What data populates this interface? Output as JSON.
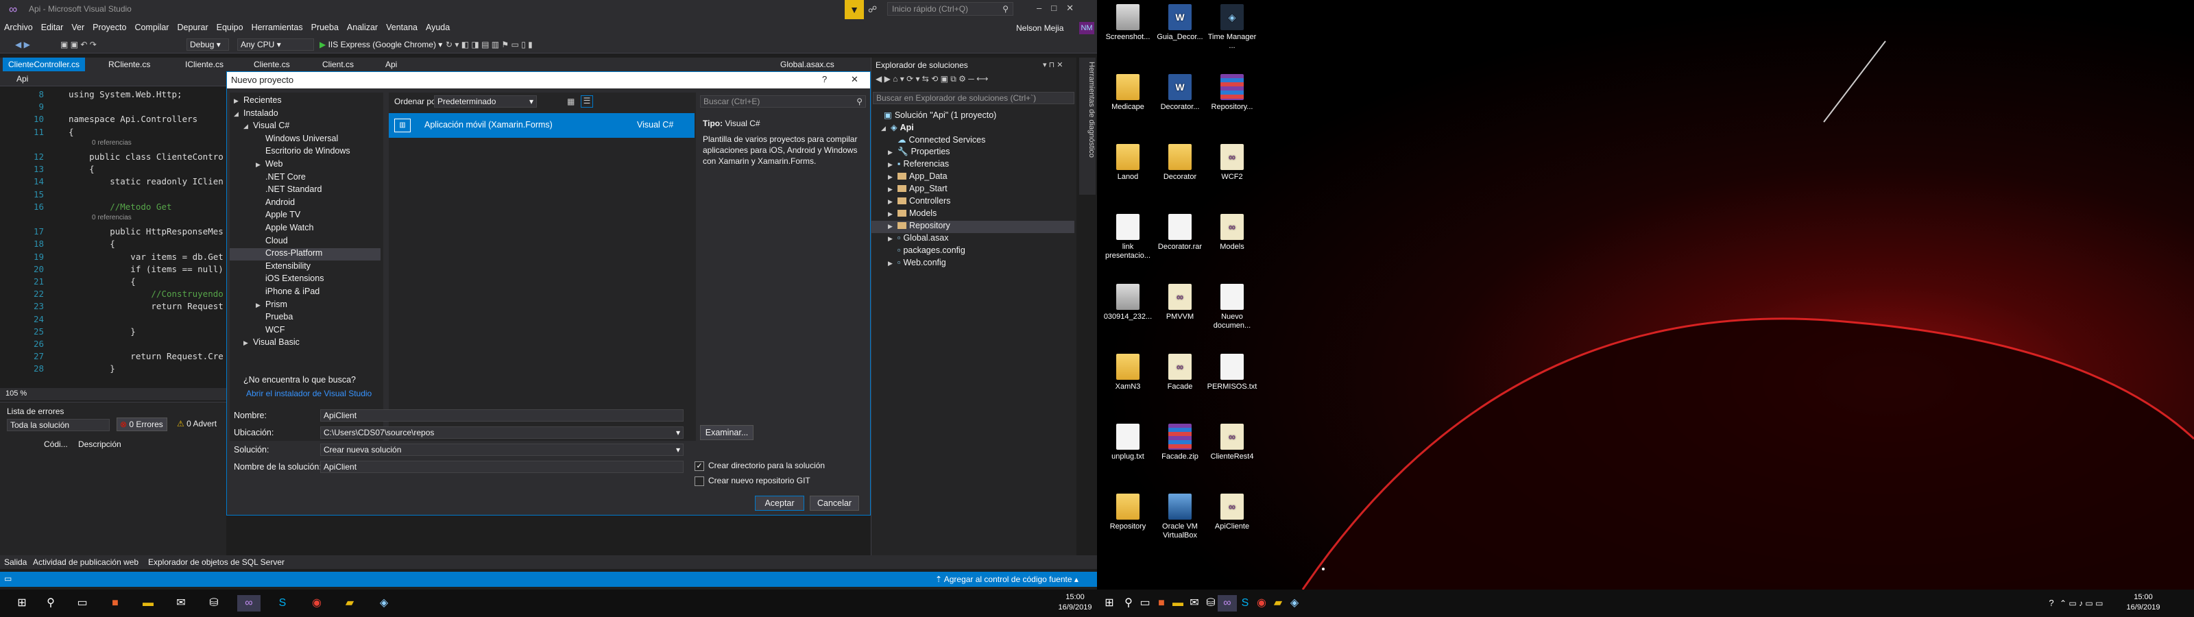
{
  "vs": {
    "title": "Api - Microsoft Visual Studio",
    "quick_launch": "Inicio rápido (Ctrl+Q)",
    "user": "Nelson Mejia",
    "user_initials": "NM",
    "menu": [
      "Archivo",
      "Editar",
      "Ver",
      "Proyecto",
      "Compilar",
      "Depurar",
      "Equipo",
      "Herramientas",
      "Prueba",
      "Analizar",
      "Ventana",
      "Ayuda"
    ],
    "toolbar": {
      "config": "Debug",
      "platform": "Any CPU",
      "run": "IIS Express (Google Chrome)"
    },
    "tabs": [
      "ClienteController.cs",
      "RCliente.cs",
      "ICliente.cs",
      "Cliente.cs",
      "Client.cs",
      "Api",
      "Global.asax.cs"
    ],
    "nav": "Api",
    "code": [
      {
        "n": "8",
        "t": "using System.Web.Http;"
      },
      {
        "n": "9",
        "t": ""
      },
      {
        "n": "10",
        "t": "namespace Api.Controllers"
      },
      {
        "n": "11",
        "t": "{"
      },
      {
        "n": "",
        "t": "0 referencias"
      },
      {
        "n": "12",
        "t": "    public class ClienteContro"
      },
      {
        "n": "13",
        "t": "    {"
      },
      {
        "n": "14",
        "t": "        static readonly IClien"
      },
      {
        "n": "15",
        "t": ""
      },
      {
        "n": "16",
        "t": "        //Metodo Get"
      },
      {
        "n": "",
        "t": "0 referencias"
      },
      {
        "n": "17",
        "t": "        public HttpResponseMes"
      },
      {
        "n": "18",
        "t": "        {"
      },
      {
        "n": "19",
        "t": "            var items = db.Get"
      },
      {
        "n": "20",
        "t": "            if (items == null)"
      },
      {
        "n": "21",
        "t": "            {"
      },
      {
        "n": "22",
        "t": "                //Construyendo"
      },
      {
        "n": "23",
        "t": "                return Request"
      },
      {
        "n": "24",
        "t": ""
      },
      {
        "n": "25",
        "t": "            }"
      },
      {
        "n": "26",
        "t": ""
      },
      {
        "n": "27",
        "t": "            return Request.Cre"
      },
      {
        "n": "28",
        "t": "        }"
      }
    ],
    "zoom": "105 %",
    "errors": {
      "title": "Lista de errores",
      "scope": "Toda la solución",
      "errors": "0 Errores",
      "warnings": "0 Advert",
      "col_code": "Códi...",
      "col_desc": "Descripción"
    },
    "bottom_tabs": [
      "Salida",
      "Actividad de publicación web",
      "Explorador de objetos de SQL Server"
    ],
    "status": "Agregar al control de código fuente"
  },
  "dialog": {
    "title": "Nuevo proyecto",
    "help": "?",
    "close": "✕",
    "tree": [
      {
        "label": "Recientes",
        "level": 0,
        "arrow": "▶"
      },
      {
        "label": "Instalado",
        "level": 0,
        "arrow": "◢"
      },
      {
        "label": "Visual C#",
        "level": 1,
        "arrow": "◢"
      },
      {
        "label": "Windows Universal",
        "level": 2,
        "arrow": ""
      },
      {
        "label": "Escritorio de Windows",
        "level": 2,
        "arrow": ""
      },
      {
        "label": "Web",
        "level": 2,
        "arrow": "▶"
      },
      {
        "label": ".NET Core",
        "level": 2,
        "arrow": ""
      },
      {
        "label": ".NET Standard",
        "level": 2,
        "arrow": ""
      },
      {
        "label": "Android",
        "level": 2,
        "arrow": ""
      },
      {
        "label": "Apple TV",
        "level": 2,
        "arrow": ""
      },
      {
        "label": "Apple Watch",
        "level": 2,
        "arrow": ""
      },
      {
        "label": "Cloud",
        "level": 2,
        "arrow": ""
      },
      {
        "label": "Cross-Platform",
        "level": 2,
        "arrow": "",
        "selected": true
      },
      {
        "label": "Extensibility",
        "level": 2,
        "arrow": ""
      },
      {
        "label": "iOS Extensions",
        "level": 2,
        "arrow": ""
      },
      {
        "label": "iPhone & iPad",
        "level": 2,
        "arrow": ""
      },
      {
        "label": "Prism",
        "level": 2,
        "arrow": "▶"
      },
      {
        "label": "Prueba",
        "level": 2,
        "arrow": ""
      },
      {
        "label": "WCF",
        "level": 2,
        "arrow": ""
      },
      {
        "label": "Visual Basic",
        "level": 1,
        "arrow": "▶"
      }
    ],
    "not_found": "¿No encuentra lo que busca?",
    "open_installer": "Abrir el instalador de Visual Studio",
    "sort_label": "Ordenar por:",
    "sort_value": "Predeterminado",
    "search_placeholder": "Buscar (Ctrl+E)",
    "template": {
      "name": "Aplicación móvil (Xamarin.Forms)",
      "lang": "Visual C#"
    },
    "type_label": "Tipo:",
    "type_value": "Visual C#",
    "description": "Plantilla de varios proyectos para compilar aplicaciones para iOS, Android y Windows con Xamarin y Xamarin.Forms.",
    "name_label": "Nombre:",
    "name_value": "ApiClient",
    "location_label": "Ubicación:",
    "location_value": "C:\\Users\\CDS07\\source\\repos",
    "solution_label": "Solución:",
    "solution_value": "Crear nueva solución",
    "solname_label": "Nombre de la solución:",
    "solname_value": "ApiClient",
    "browse": "Examinar...",
    "create_dir": "Crear directorio para la solución",
    "create_git": "Crear nuevo repositorio GIT",
    "ok": "Aceptar",
    "cancel": "Cancelar"
  },
  "solution_explorer": {
    "title": "Explorador de soluciones",
    "search": "Buscar en Explorador de soluciones (Ctrl+`)",
    "side_tab": "Herramientas de diagnóstico",
    "items": [
      {
        "label": "Solución \"Api\" (1 proyecto)",
        "level": 0,
        "icon": "solution"
      },
      {
        "label": "Api",
        "level": 1,
        "icon": "project",
        "bold": true
      },
      {
        "label": "Connected Services",
        "level": 2,
        "icon": "service"
      },
      {
        "label": "Properties",
        "level": 2,
        "icon": "wrench"
      },
      {
        "label": "Referencias",
        "level": 2,
        "icon": "refs"
      },
      {
        "label": "App_Data",
        "level": 2,
        "icon": "folder"
      },
      {
        "label": "App_Start",
        "level": 2,
        "icon": "folder"
      },
      {
        "label": "Controllers",
        "level": 2,
        "icon": "folder"
      },
      {
        "label": "Models",
        "level": 2,
        "icon": "folder"
      },
      {
        "label": "Repository",
        "level": 2,
        "icon": "folder",
        "selected": true
      },
      {
        "label": "Global.asax",
        "level": 2,
        "icon": "file"
      },
      {
        "label": "packages.config",
        "level": 2,
        "icon": "file"
      },
      {
        "label": "Web.config",
        "level": 2,
        "icon": "file"
      }
    ]
  },
  "taskbar": {
    "time": "15:00",
    "date": "16/9/2019"
  },
  "desktop": [
    {
      "label": "Screenshot...",
      "kind": "img"
    },
    {
      "label": "Guia_Decor...",
      "kind": "word"
    },
    {
      "label": "Time Manager ...",
      "kind": "tm"
    },
    {
      "label": "Medicape",
      "kind": "folder"
    },
    {
      "label": "Decorator...",
      "kind": "word"
    },
    {
      "label": "Repository...",
      "kind": "rar"
    },
    {
      "label": "Lanod",
      "kind": "folder"
    },
    {
      "label": "Decorator",
      "kind": "folder"
    },
    {
      "label": "WCF2",
      "kind": "vsf"
    },
    {
      "label": "link presentacio...",
      "kind": "fileb"
    },
    {
      "label": "Decorator.rar",
      "kind": "fileb"
    },
    {
      "label": "Models",
      "kind": "vsf"
    },
    {
      "label": "030914_232...",
      "kind": "img"
    },
    {
      "label": "PMVVM",
      "kind": "vsf"
    },
    {
      "label": "Nuevo documen...",
      "kind": "fileb"
    },
    {
      "label": "XamN3",
      "kind": "folder"
    },
    {
      "label": "Facade",
      "kind": "vsf"
    },
    {
      "label": "PERMISOS.txt",
      "kind": "fileb"
    },
    {
      "label": "unplug.txt",
      "kind": "fileb"
    },
    {
      "label": "Facade.zip",
      "kind": "rar"
    },
    {
      "label": "ClienteRest4",
      "kind": "vsf"
    },
    {
      "label": "Repository",
      "kind": "folder"
    },
    {
      "label": "Oracle VM VirtualBox",
      "kind": "vbox"
    },
    {
      "label": "ApiCliente",
      "kind": "vsf"
    }
  ]
}
